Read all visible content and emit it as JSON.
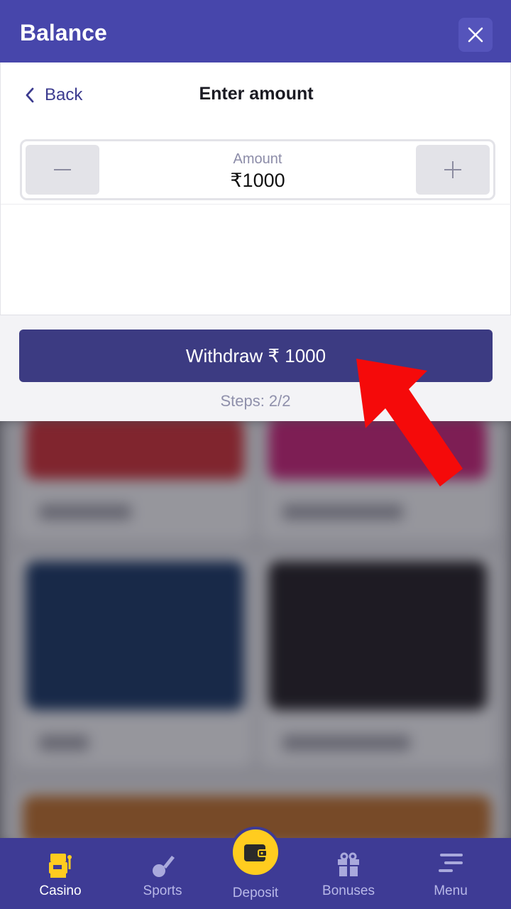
{
  "header": {
    "title": "Balance"
  },
  "panel": {
    "back_label": "Back",
    "title": "Enter amount",
    "amount_label": "Amount",
    "amount_value": "₹1000"
  },
  "action": {
    "withdraw_label": "Withdraw ₹ 1000",
    "steps_label": "Steps: 2/2"
  },
  "nav": {
    "items": [
      {
        "label": "Casino",
        "icon": "slot-machine-icon",
        "active": true
      },
      {
        "label": "Sports",
        "icon": "cricket-bat-icon"
      },
      {
        "label": "Deposit",
        "icon": "wallet-icon"
      },
      {
        "label": "Bonuses",
        "icon": "gift-icon"
      },
      {
        "label": "Menu",
        "icon": "menu-icon"
      }
    ]
  },
  "colors": {
    "header": "#4746ab",
    "button": "#3c3b82",
    "nav": "#3e3b95",
    "deposit_accent": "#ffcc1f",
    "arrow": "#f50a0a"
  }
}
